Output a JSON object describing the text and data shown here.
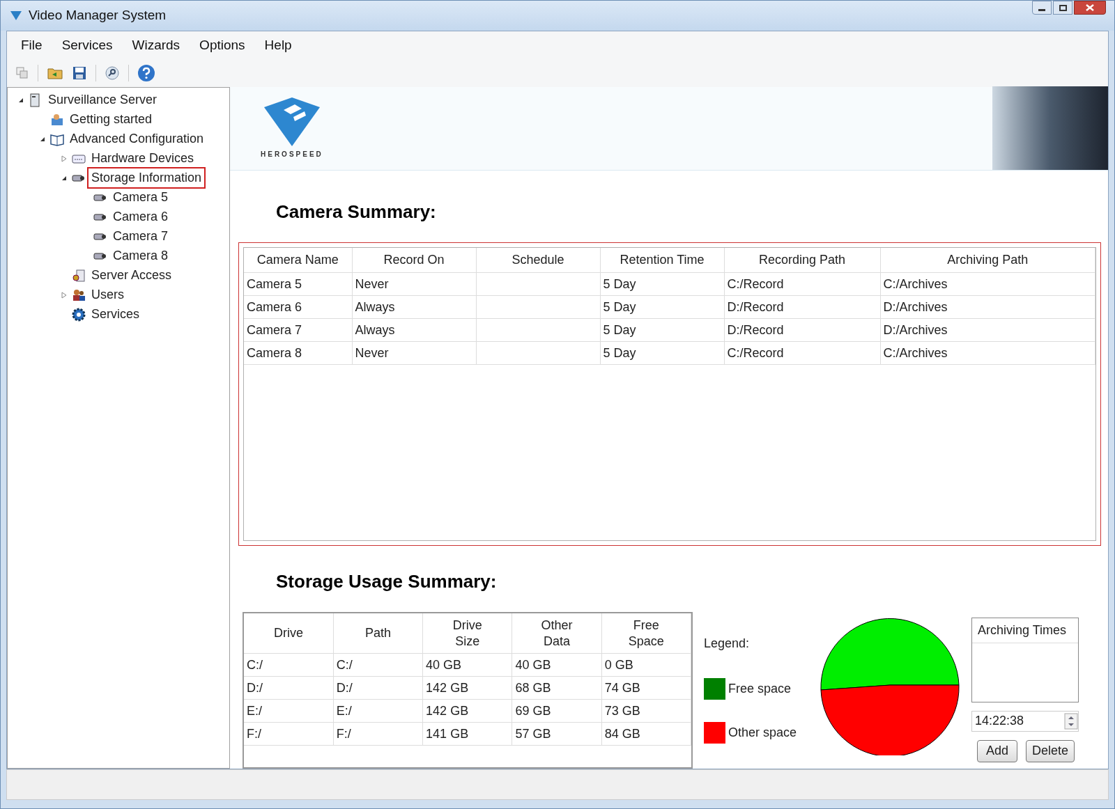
{
  "window": {
    "title": "Video Manager System"
  },
  "menu": [
    "File",
    "Services",
    "Wizards",
    "Options",
    "Help"
  ],
  "tree": [
    {
      "label": "Surveillance Server",
      "kind": "server",
      "expanded": true,
      "selected": false,
      "children": [
        {
          "label": "Getting started",
          "kind": "start",
          "selected": false
        },
        {
          "label": "Advanced Configuration",
          "kind": "book",
          "expanded": true,
          "selected": false,
          "children": [
            {
              "label": "Hardware Devices",
              "kind": "device",
              "expanded": false,
              "selected": false
            },
            {
              "label": "Storage Information",
              "kind": "camera",
              "expanded": true,
              "selected": true,
              "children": [
                {
                  "label": "Camera 5",
                  "kind": "camera",
                  "selected": false
                },
                {
                  "label": "Camera 6",
                  "kind": "camera",
                  "selected": false
                },
                {
                  "label": "Camera 7",
                  "kind": "camera",
                  "selected": false
                },
                {
                  "label": "Camera 8",
                  "kind": "camera",
                  "selected": false
                }
              ]
            },
            {
              "label": "Server Access",
              "kind": "key",
              "selected": false
            },
            {
              "label": "Users",
              "kind": "users",
              "expanded": false,
              "selected": false
            },
            {
              "label": "Services",
              "kind": "gear",
              "selected": false
            }
          ]
        }
      ]
    }
  ],
  "banner": {
    "logo_text": "HEROSPEED"
  },
  "camera_summary": {
    "title": "Camera Summary:",
    "columns": [
      "Camera Name",
      "Record On",
      "Schedule",
      "Retention Time",
      "Recording Path",
      "Archiving Path"
    ],
    "rows": [
      [
        "Camera 5",
        "Never",
        "",
        "5 Day",
        "C:/Record",
        "C:/Archives"
      ],
      [
        "Camera 6",
        "Always",
        "",
        "5 Day",
        "D:/Record",
        "D:/Archives"
      ],
      [
        "Camera 7",
        "Always",
        "",
        "5 Day",
        "D:/Record",
        "D:/Archives"
      ],
      [
        "Camera 8",
        "Never",
        "",
        "5 Day",
        "C:/Record",
        "C:/Archives"
      ]
    ]
  },
  "storage_summary": {
    "title": "Storage Usage Summary:",
    "columns": [
      "Drive",
      "Path",
      "Drive Size",
      "Other Data",
      "Free Space"
    ],
    "rows": [
      [
        "C:/",
        "C:/",
        "40 GB",
        "40 GB",
        "0 GB"
      ],
      [
        "D:/",
        "D:/",
        "142 GB",
        "68 GB",
        "74 GB"
      ],
      [
        "E:/",
        "E:/",
        "142 GB",
        "69 GB",
        "73 GB"
      ],
      [
        "F:/",
        "F:/",
        "141 GB",
        "57 GB",
        "84 GB"
      ]
    ],
    "legend_title": "Legend:",
    "legend": [
      {
        "label": "Free space",
        "color": "#008000"
      },
      {
        "label": "Other space",
        "color": "#ff0000"
      }
    ]
  },
  "archiving": {
    "title": "Archiving Times",
    "time": "14:22:38",
    "buttons": [
      "Add",
      "Delete"
    ]
  }
}
